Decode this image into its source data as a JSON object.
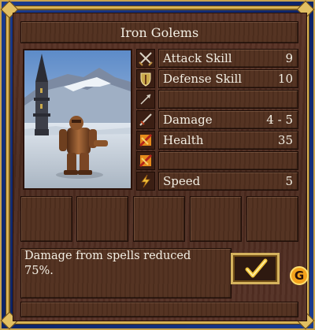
{
  "window": {
    "title": "Iron Golems"
  },
  "creature": {
    "portrait_icon": "iron-golem-portrait",
    "stats": [
      {
        "key": "attack",
        "icon": "crossed-swords-icon",
        "label": "Attack Skill",
        "value": "9"
      },
      {
        "key": "defense",
        "icon": "shield-icon",
        "label": "Defense Skill",
        "value": "10"
      },
      {
        "key": "shots",
        "icon": "arrow-icon",
        "label": "",
        "value": ""
      },
      {
        "key": "damage",
        "icon": "sword-icon",
        "label": "Damage",
        "value": "4 - 5"
      },
      {
        "key": "health",
        "icon": "heart-cross-icon",
        "label": "Health",
        "value": "35"
      },
      {
        "key": "health-left",
        "icon": "heart-cross-icon",
        "label": "",
        "value": ""
      },
      {
        "key": "speed",
        "icon": "lightning-icon",
        "label": "Speed",
        "value": "5"
      }
    ]
  },
  "spell_slots": [
    "",
    "",
    "",
    "",
    ""
  ],
  "description": "Damage from spells reduced 75%.",
  "ok_button": {
    "icon": "checkmark-icon"
  },
  "badge": {
    "label": "G"
  },
  "status_bar": {
    "text": ""
  },
  "colors": {
    "frame_gold": "#d8b356",
    "panel_brown": "#52301f",
    "outer_blue": "#1a3b8f",
    "text": "#f3efe4",
    "checkmark": "#f1c43a"
  }
}
